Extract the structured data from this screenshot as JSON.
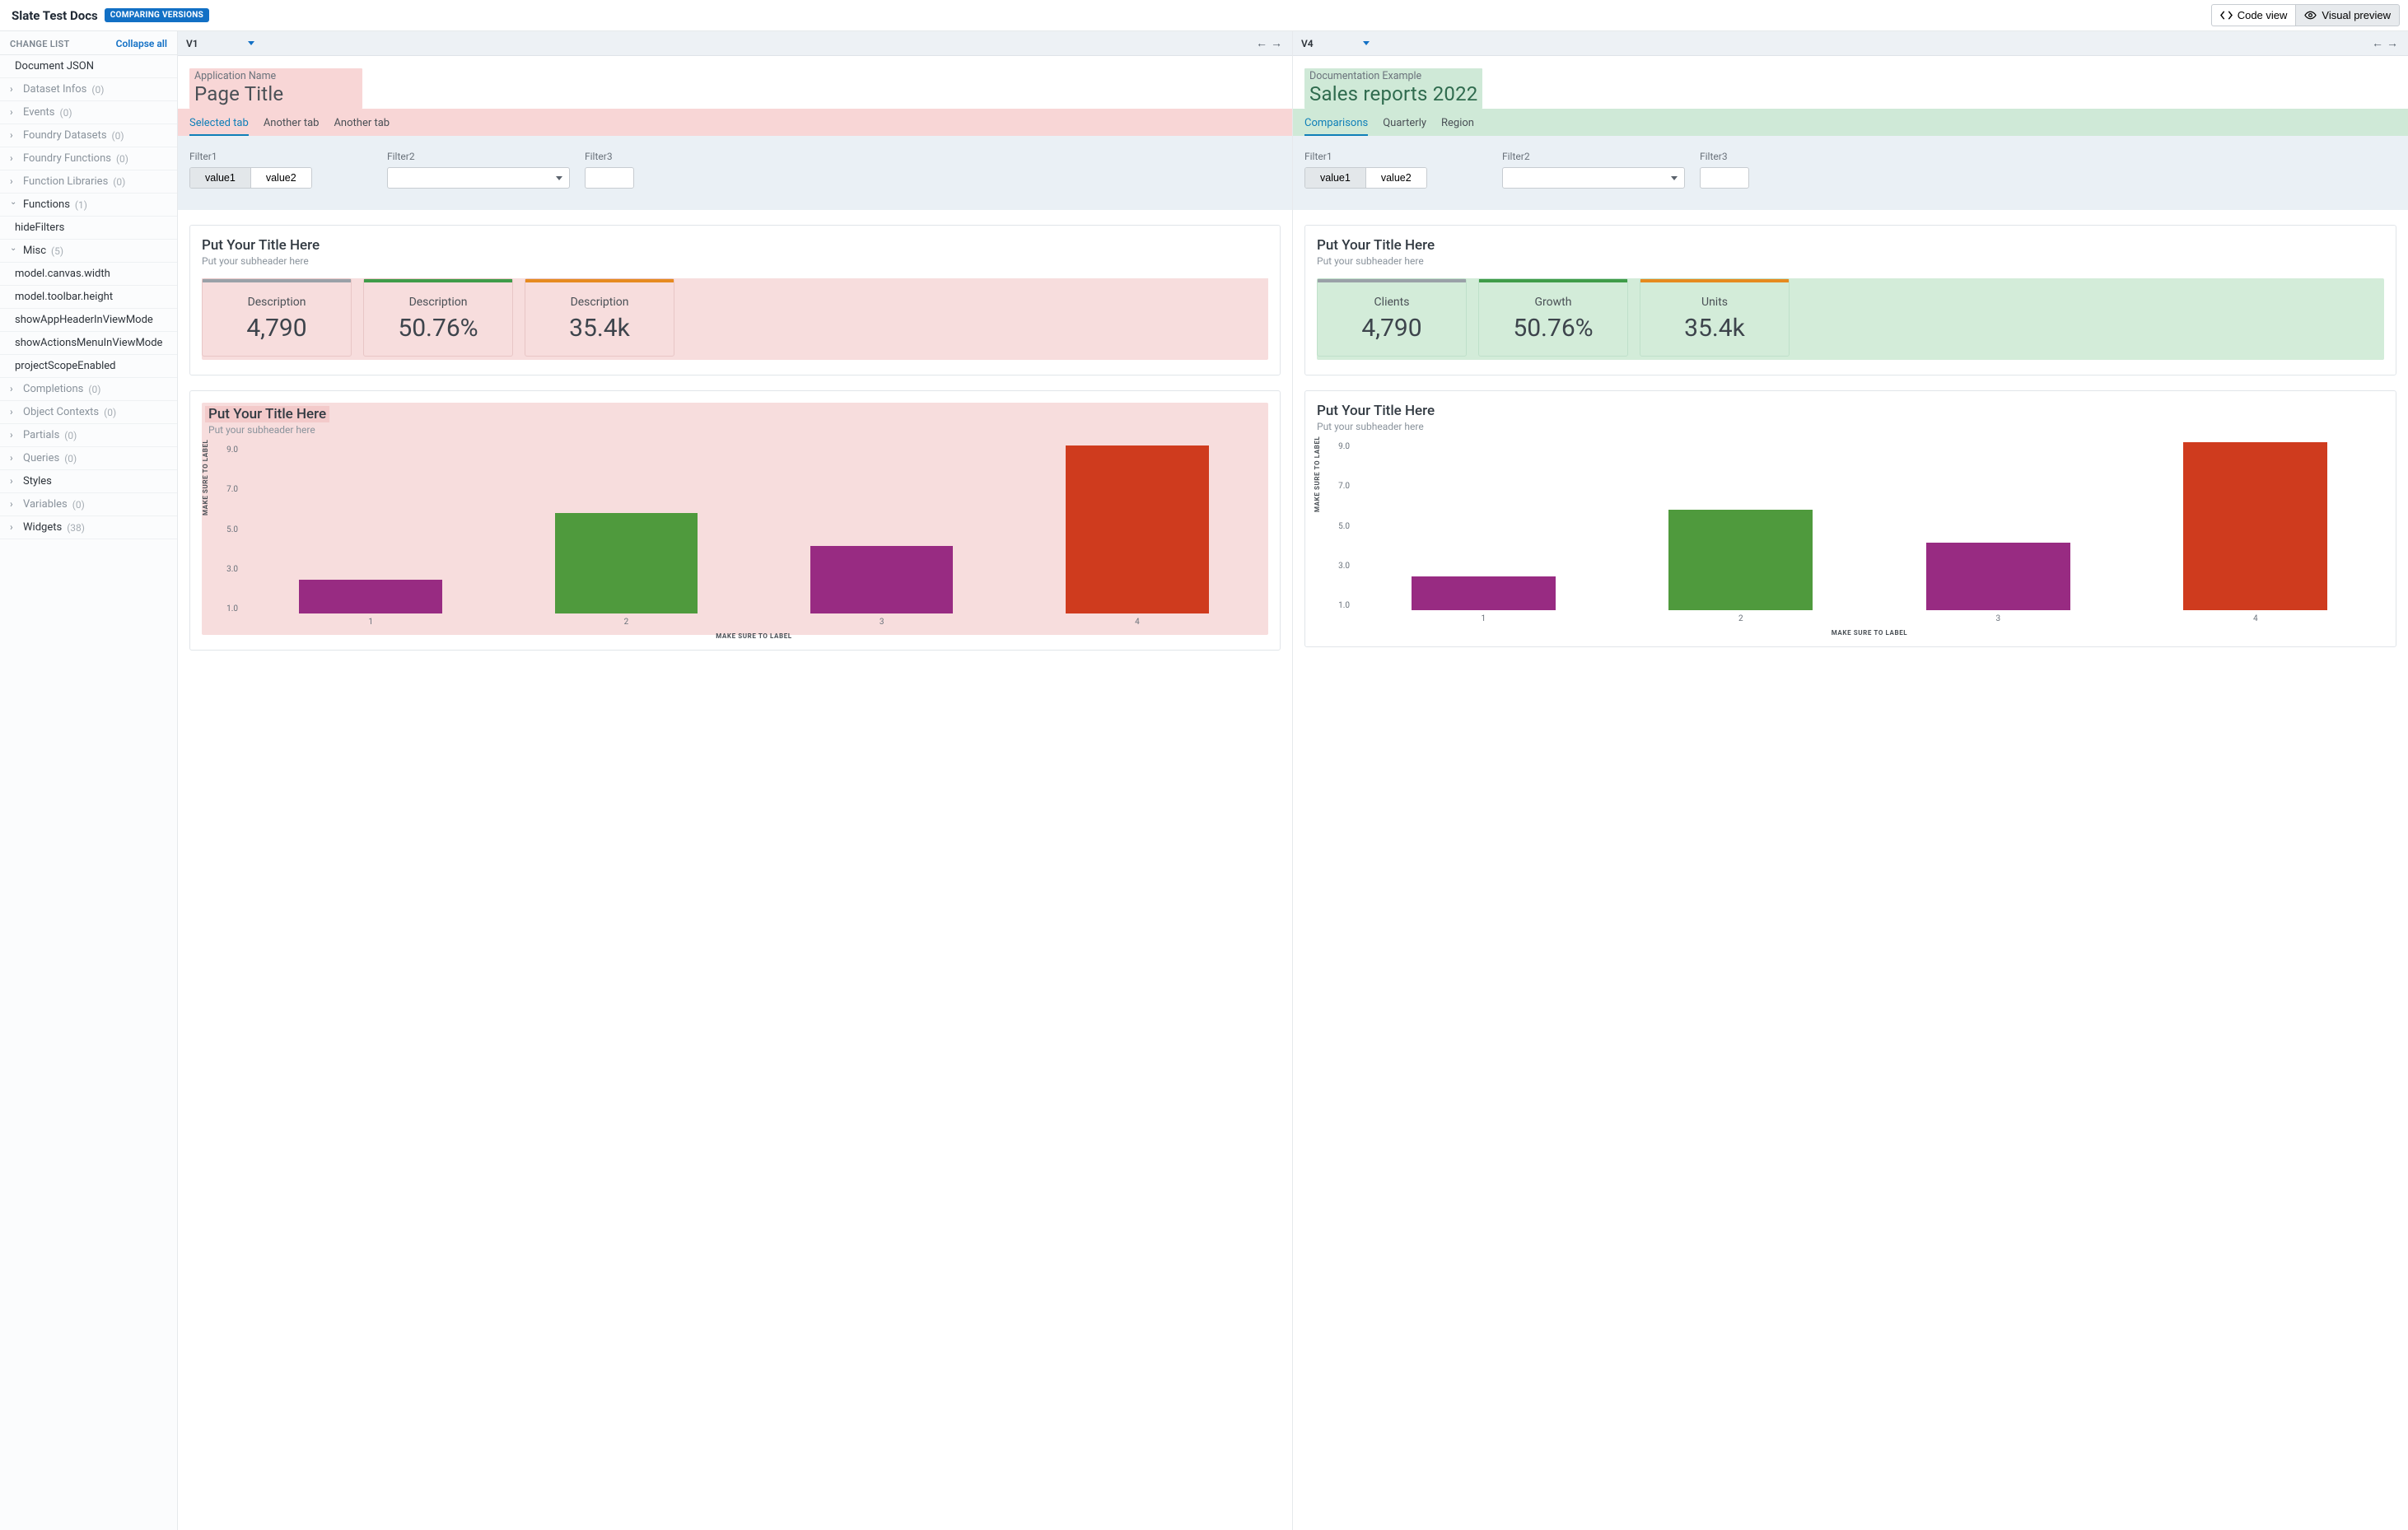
{
  "header": {
    "title": "Slate Test Docs",
    "badge": "COMPARING VERSIONS",
    "code_view_label": "Code view",
    "visual_preview_label": "Visual preview"
  },
  "sidebar": {
    "header_label": "CHANGE LIST",
    "collapse_label": "Collapse all",
    "items": [
      {
        "label": "Document JSON",
        "type": "leaf",
        "muted": false
      },
      {
        "label": "Dataset Infos",
        "count": "(0)",
        "type": "branch",
        "muted": true
      },
      {
        "label": "Events",
        "count": "(0)",
        "type": "branch",
        "muted": true
      },
      {
        "label": "Foundry Datasets",
        "count": "(0)",
        "type": "branch",
        "muted": true
      },
      {
        "label": "Foundry Functions",
        "count": "(0)",
        "type": "branch",
        "muted": true
      },
      {
        "label": "Function Libraries",
        "count": "(0)",
        "type": "branch",
        "muted": true
      },
      {
        "label": "Functions",
        "count": "(1)",
        "type": "branch",
        "muted": false,
        "open": true
      },
      {
        "label": "hideFilters",
        "type": "leaf",
        "muted": false
      },
      {
        "label": "Misc",
        "count": "(5)",
        "type": "branch",
        "muted": false,
        "open": true
      },
      {
        "label": "model.canvas.width",
        "type": "leaf",
        "muted": false
      },
      {
        "label": "model.toolbar.height",
        "type": "leaf",
        "muted": false
      },
      {
        "label": "showAppHeaderInViewMode",
        "type": "leaf",
        "muted": false
      },
      {
        "label": "showActionsMenuInViewMode",
        "type": "leaf",
        "muted": false
      },
      {
        "label": "projectScopeEnabled",
        "type": "leaf",
        "muted": false
      },
      {
        "label": "Completions",
        "count": "(0)",
        "type": "branch",
        "muted": true
      },
      {
        "label": "Object Contexts",
        "count": "(0)",
        "type": "branch",
        "muted": true
      },
      {
        "label": "Partials",
        "count": "(0)",
        "type": "branch",
        "muted": true
      },
      {
        "label": "Queries",
        "count": "(0)",
        "type": "branch",
        "muted": true
      },
      {
        "label": "Styles",
        "type": "branch",
        "muted": false
      },
      {
        "label": "Variables",
        "count": "(0)",
        "type": "branch",
        "muted": true
      },
      {
        "label": "Widgets",
        "count": "(38)",
        "type": "branch",
        "muted": false
      }
    ]
  },
  "left": {
    "version": "V1",
    "app_name": "Application Name",
    "page_title": "Page Title",
    "tabs": [
      "Selected tab",
      "Another tab",
      "Another tab"
    ],
    "filters": {
      "f1_label": "Filter1",
      "f1_opts": [
        "value1",
        "value2"
      ],
      "f2_label": "Filter2",
      "f3_label": "Filter3"
    },
    "metrics_title": "Put Your Title Here",
    "metrics_sub": "Put your subheader here",
    "metrics": [
      {
        "label": "Description",
        "value": "4,790",
        "color": "grey"
      },
      {
        "label": "Description",
        "value": "50.76%",
        "color": "green"
      },
      {
        "label": "Description",
        "value": "35.4k",
        "color": "orange"
      }
    ],
    "chart_title": "Put Your Title Here",
    "chart_sub": "Put your subheader here"
  },
  "right": {
    "version": "V4",
    "app_name": "Documentation Example",
    "page_title": "Sales reports 2022",
    "tabs": [
      "Comparisons",
      "Quarterly",
      "Region"
    ],
    "filters": {
      "f1_label": "Filter1",
      "f1_opts": [
        "value1",
        "value2"
      ],
      "f2_label": "Filter2",
      "f3_label": "Filter3"
    },
    "metrics_title": "Put Your Title Here",
    "metrics_sub": "Put your subheader here",
    "metrics": [
      {
        "label": "Clients",
        "value": "4,790",
        "color": "grey"
      },
      {
        "label": "Growth",
        "value": "50.76%",
        "color": "green"
      },
      {
        "label": "Units",
        "value": "35.4k",
        "color": "orange"
      }
    ],
    "chart_title": "Put Your Title Here",
    "chart_sub": "Put your subheader here"
  },
  "chart_data": {
    "type": "bar",
    "categories": [
      "1",
      "2",
      "3",
      "4"
    ],
    "values": [
      2.0,
      6.0,
      4.0,
      10.0
    ],
    "xlabel": "MAKE SURE TO LABEL",
    "ylabel": "MAKE SURE TO LABEL",
    "yticks": [
      1.0,
      3.0,
      5.0,
      7.0,
      9.0
    ],
    "ylim": [
      0,
      10
    ],
    "colors": [
      "#982b82",
      "#4f9a3d",
      "#982b82",
      "#cf3b1e"
    ]
  }
}
